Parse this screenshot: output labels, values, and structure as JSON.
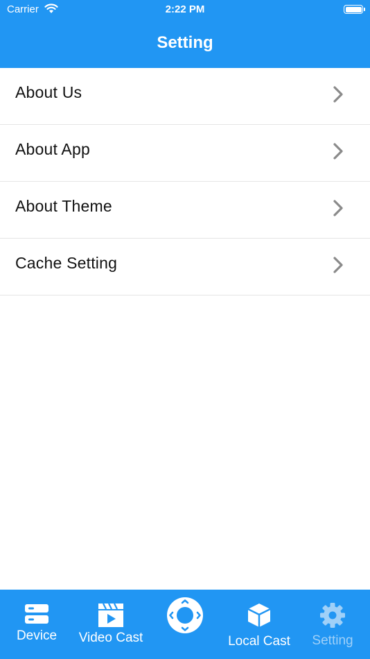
{
  "status_bar": {
    "carrier": "Carrier",
    "time": "2:22 PM"
  },
  "nav": {
    "title": "Setting"
  },
  "settings": {
    "items": [
      {
        "label": "About Us"
      },
      {
        "label": "About App"
      },
      {
        "label": "About Theme"
      },
      {
        "label": "Cache Setting"
      }
    ]
  },
  "tabbar": {
    "tabs": [
      {
        "label": "Device",
        "icon": "device-icon"
      },
      {
        "label": "Video Cast",
        "icon": "video-cast-icon"
      },
      {
        "label": "",
        "icon": "remote-control-icon"
      },
      {
        "label": "Local Cast",
        "icon": "cube-icon"
      },
      {
        "label": "Setting",
        "icon": "gear-icon",
        "active": true
      }
    ]
  },
  "colors": {
    "primary": "#2196F3",
    "active_tab": "#9fd0f8",
    "chevron": "#8a8a8a",
    "divider": "#e5e5e5"
  }
}
